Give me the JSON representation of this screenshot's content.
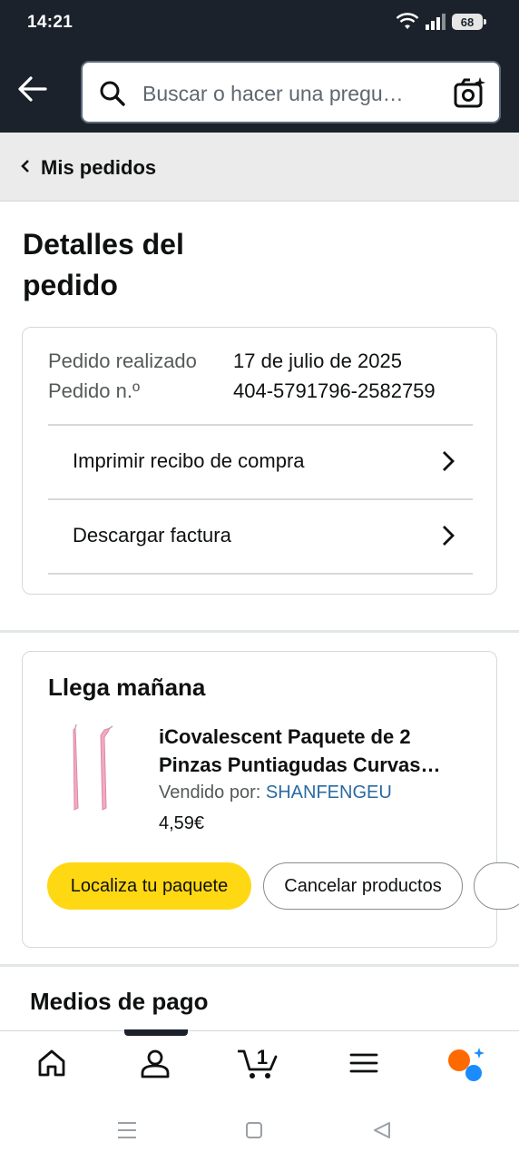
{
  "status_bar": {
    "time": "14:21",
    "battery": "68"
  },
  "search": {
    "placeholder": "Buscar o hacer una pregu…"
  },
  "breadcrumb": {
    "label": "Mis pedidos"
  },
  "page_title": "Detalles del pedido",
  "order": {
    "placed_label": "Pedido realizado",
    "placed_value": "17 de julio de 2025",
    "number_label": "Pedido n.º",
    "number_value": "404-5791796-2582759",
    "links": [
      {
        "label": "Imprimir recibo de compra"
      },
      {
        "label": "Descargar factura"
      }
    ]
  },
  "delivery": {
    "heading": "Llega mañana",
    "product": {
      "title": "iCovalescent Paquete de 2 Pinzas Puntiagudas Curvas…",
      "sold_by_label": "Vendido por:",
      "seller": "SHANFENGEU",
      "price": "4,59€"
    },
    "buttons": {
      "track": "Localiza tu paquete",
      "cancel": "Cancelar productos"
    }
  },
  "payment": {
    "heading": "Medios de pago"
  },
  "bottom_nav": {
    "items": [
      {
        "icon": "home-icon"
      },
      {
        "icon": "account-icon",
        "active": true
      },
      {
        "icon": "cart-icon",
        "badge": "1"
      },
      {
        "icon": "menu-icon"
      },
      {
        "icon": "rufus-assistant-icon"
      }
    ]
  },
  "colors": {
    "header_bg": "#1b222b",
    "primary_button": "#ffd814",
    "link": "#2a6aa0",
    "assistant_orange": "#ff6a00",
    "assistant_blue": "#1a8cff"
  }
}
